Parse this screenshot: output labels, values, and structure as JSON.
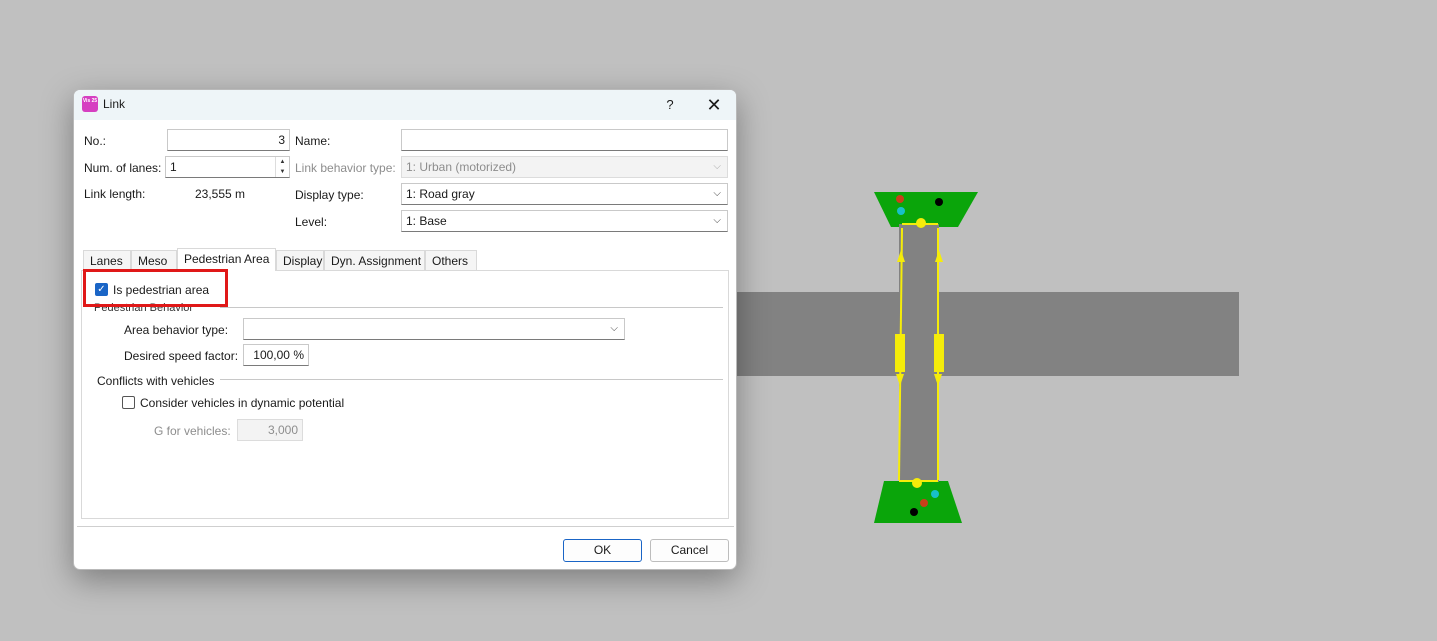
{
  "dialog": {
    "title": "Link",
    "icon_text": "Vis 25",
    "help_label": "?",
    "close_label": "✕"
  },
  "form": {
    "no_label": "No.:",
    "no_value": "3",
    "name_label": "Name:",
    "name_value": "",
    "lanes_label": "Num. of lanes:",
    "lanes_value": "1",
    "link_behavior_label": "Link behavior type:",
    "link_behavior_value": "1: Urban (motorized)",
    "link_length_label": "Link length:",
    "link_length_value": "23,555 m",
    "display_type_label": "Display type:",
    "display_type_value": "1: Road gray",
    "level_label": "Level:",
    "level_value": "1: Base"
  },
  "tabs": [
    {
      "label": "Lanes"
    },
    {
      "label": "Meso"
    },
    {
      "label": "Pedestrian Area",
      "active": true
    },
    {
      "label": "Display"
    },
    {
      "label": "Dyn. Assignment"
    },
    {
      "label": "Others"
    }
  ],
  "pedestrian": {
    "is_pedestrian_label": "Is pedestrian area",
    "is_pedestrian_checked": true,
    "behavior_group_label": "Pedestrian Behavior",
    "area_behavior_label": "Area behavior type:",
    "area_behavior_value": "",
    "speed_factor_label": "Desired speed factor:",
    "speed_factor_value": "100,00 %",
    "conflicts_group_label": "Conflicts with vehicles",
    "consider_vehicles_label": "Consider vehicles in dynamic potential",
    "consider_vehicles_checked": false,
    "g_vehicles_label": "G for vehicles:",
    "g_vehicles_value": "3,000"
  },
  "buttons": {
    "ok_label": "OK",
    "cancel_label": "Cancel"
  },
  "colors": {
    "canvas_bg": "#c0c0c0",
    "road_gray": "#828282",
    "area_green": "#0aa50a",
    "signal_yellow": "#f5ec0a",
    "highlight_red": "#e01818",
    "accent_blue": "#1a65c6"
  }
}
